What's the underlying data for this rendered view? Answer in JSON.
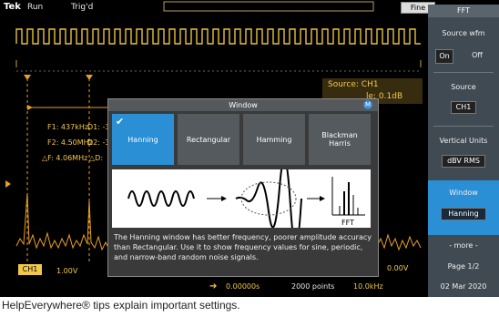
{
  "topbar": {
    "brand": "Tek",
    "mode": "Run",
    "trigger": "Trig'd",
    "fine": "Fine"
  },
  "panel": {
    "title": "FFT",
    "source_wfm": "Source wfm",
    "on": "On",
    "off": "Off",
    "source": "Source",
    "source_val": "CH1",
    "vertical_units": "Vertical Units",
    "vertical_val": "dBV RMS",
    "window": "Window",
    "window_val": "Hanning",
    "more": "- more -",
    "page": "Page 1/2"
  },
  "overlay": {
    "source": "Source: CH1",
    "scale": "le: 0.1dB",
    "f1": "F1: 437kHz",
    "d1": "D1: -3",
    "f2": "F2: 4.50MHz",
    "d2": "D2: -3",
    "df": "△F: 4.06MHz",
    "dd": "△D:"
  },
  "dialog": {
    "title": "Window",
    "badge": "M",
    "options": [
      "Hanning",
      "Rectangular",
      "Hamming",
      "Blackman\nHarris"
    ],
    "selected": "Hanning",
    "fft_label": "FFT",
    "help": "The Hanning window has better frequency, poorer amplitude accuracy than Rectangular. Use it to show frequency values for sine, periodic, and narrow-band random noise signals."
  },
  "bottombar": {
    "ch": "CH1",
    "volt": "1.00V",
    "pos": "0.00000s",
    "points": "2000 points",
    "freq": "10.0kHz",
    "level": "0.00V",
    "date": "02 Mar 2020"
  },
  "caption": "HelpEverywhere® tips explain important settings."
}
